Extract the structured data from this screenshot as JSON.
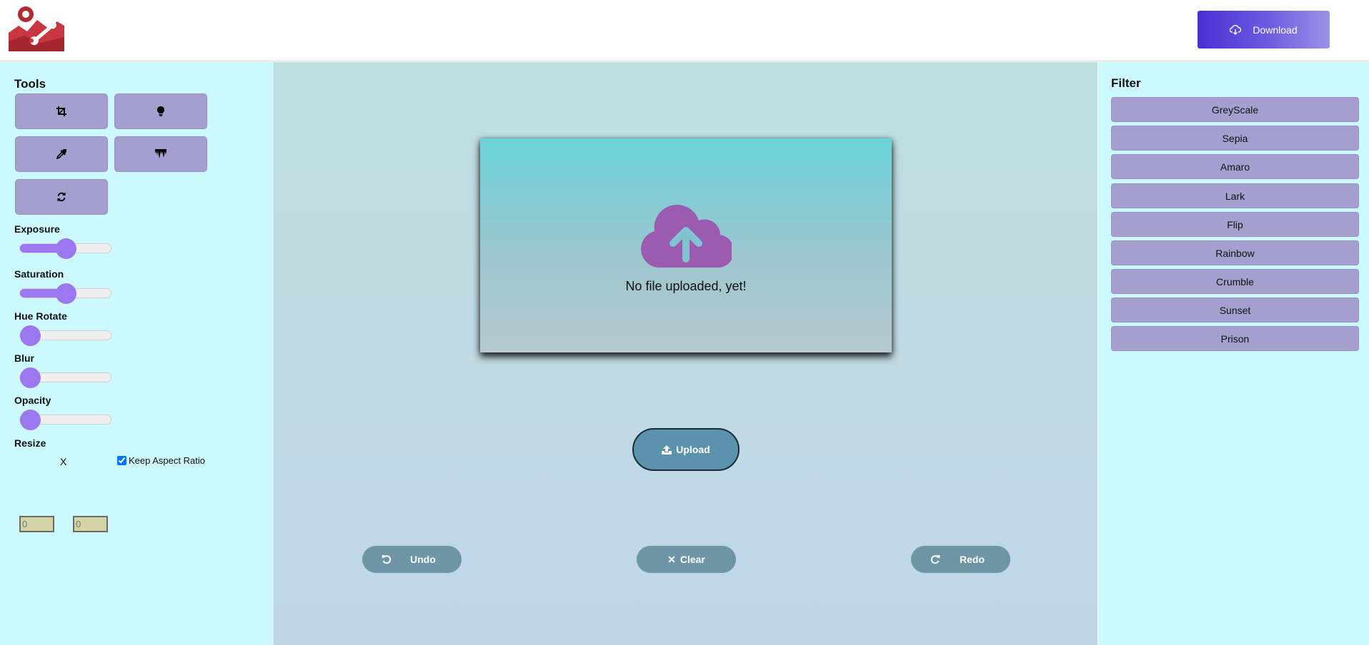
{
  "header": {
    "download_label": "Download",
    "logo_icon": "app-logo-icon",
    "download_icon": "cloud-download-icon",
    "accent_color": "#4a2fd6"
  },
  "tools": {
    "title": "Tools",
    "buttons": [
      {
        "name": "crop",
        "icon": "crop-icon"
      },
      {
        "name": "brightness",
        "icon": "lightbulb-icon"
      },
      {
        "name": "color-picker",
        "icon": "eyedropper-icon"
      },
      {
        "name": "drip",
        "icon": "drip-icon"
      },
      {
        "name": "rotate",
        "icon": "rotate-icon"
      }
    ],
    "sliders": [
      {
        "label": "Exposure",
        "value": 0.5
      },
      {
        "label": "Saturation",
        "value": 0.5
      },
      {
        "label": "Hue Rotate",
        "value": 0
      },
      {
        "label": "Blur",
        "value": 0
      },
      {
        "label": "Opacity",
        "value": 0
      }
    ],
    "slider_color": "#9b78f0",
    "resize": {
      "label": "Resize",
      "width_value": "0",
      "height_value": "0",
      "separator": "X",
      "keep_aspect_label": "Keep Aspect Ratio",
      "keep_aspect_checked": true
    }
  },
  "canvas": {
    "empty_text": "No file uploaded, yet!",
    "upload_icon": "cloud-upload-icon",
    "icon_color": "#9b5bb0"
  },
  "actions": {
    "upload_label": "Upload",
    "undo_label": "Undo",
    "clear_label": "Clear",
    "redo_label": "Redo"
  },
  "filters": {
    "title": "Filter",
    "items": [
      "GreyScale",
      "Sepia",
      "Amaro",
      "Lark",
      "Flip",
      "Rainbow",
      "Crumble",
      "Sunset",
      "Prison"
    ]
  }
}
